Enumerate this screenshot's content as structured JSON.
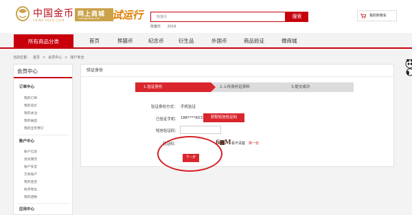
{
  "header": {
    "logo_cn": "中国金币",
    "logo_en": "CHINA GOLD COIN",
    "shop_cn": "网上商城",
    "shop_en": "chinagoldcoin.net",
    "slogan": "试运行",
    "search_placeholder": "熊猫币",
    "search_button": "搜索",
    "hot_words": [
      "熊猫币",
      "2019"
    ],
    "cart_label": "我的购物车"
  },
  "nav": {
    "category_label": "所有商品分类",
    "items": [
      "首页",
      "熊猫币",
      "纪念币",
      "衍生品",
      "外国币",
      "商品验证",
      "微商城"
    ]
  },
  "breadcrumb": [
    "当前位置：",
    "首页",
    ">",
    "会员中心",
    ">",
    "账户安全"
  ],
  "sidebar": {
    "title": "会员中心",
    "groups": [
      {
        "title": "订单中心",
        "items": [
          "我的订单",
          "我的竞价",
          "我的关注",
          "我的抽签",
          "我的全年预订"
        ]
      },
      {
        "title": "账户中心",
        "items": [
          "账户信息",
          "会员服务",
          "账户安全",
          "交易账户",
          "我的金豆",
          "收货地址",
          "我的函数"
        ]
      },
      {
        "title": "应用中心",
        "items": []
      }
    ]
  },
  "main": {
    "title": "验证身份",
    "steps": [
      "1.验证身份",
      "2.上传身份证资料",
      "3.提交成功"
    ],
    "form": {
      "method_label": "验证身份方式：",
      "method_value": "手机验证",
      "phone_label": "已验证手机：",
      "phone_value": "186****6033",
      "get_code_button": "获取短信验证码",
      "sms_label": "短信验证码：",
      "captcha_label": "验证码：",
      "captcha_text": "6■M",
      "captcha_hint": "看不清楚",
      "captcha_refresh": "换一张",
      "next_button": "下一步"
    }
  },
  "colors": {
    "brand_red": "#c7000b",
    "step_red": "#d9262d",
    "gold": "#c9a24a",
    "annotation_red": "#d61f26"
  }
}
